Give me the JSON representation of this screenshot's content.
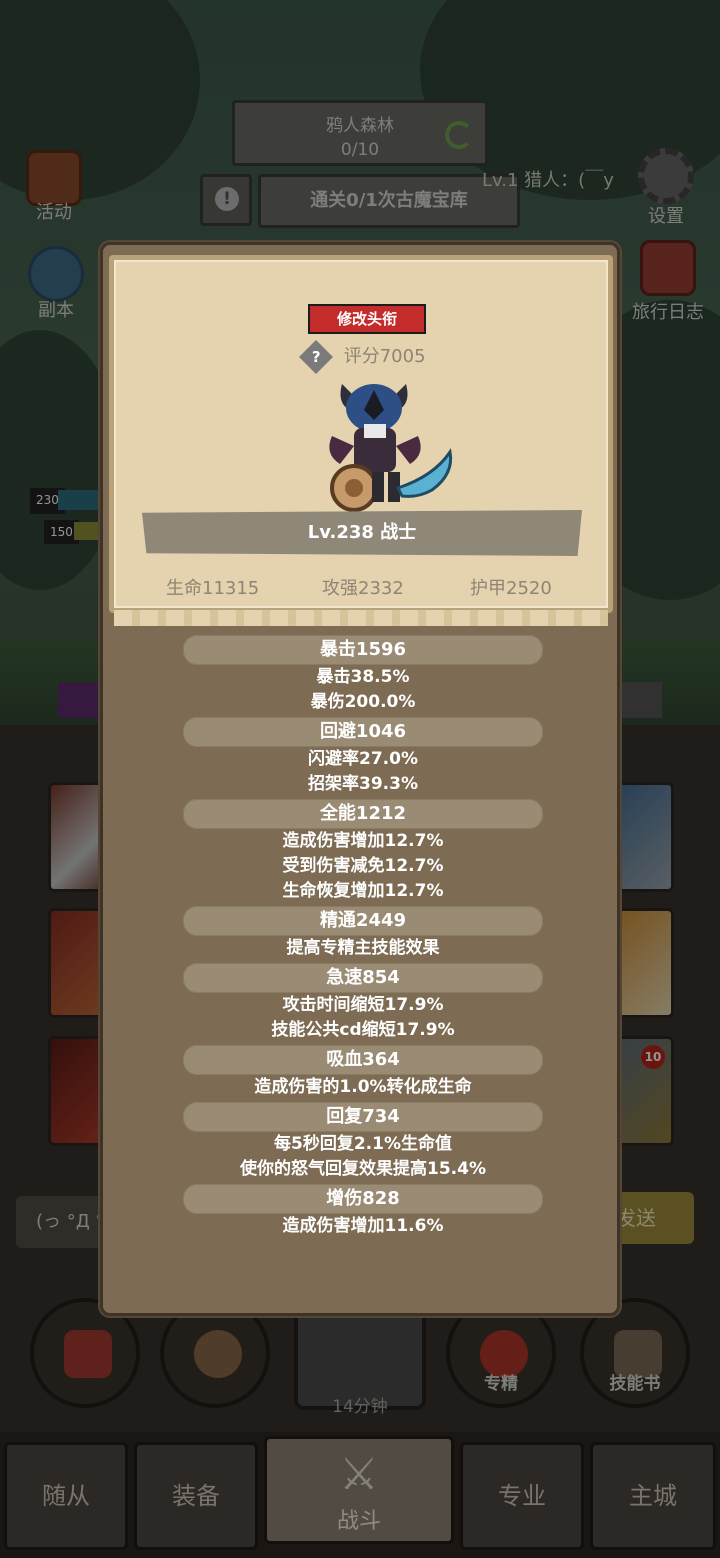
{
  "area": {
    "name": "鸦人森林",
    "progress": "0/10"
  },
  "quest": {
    "text": "通关0/1次古魔宝库",
    "icon": "!"
  },
  "hunter_label": "Lv.1 猎人：(￣y",
  "side_menu": {
    "activity": "活动",
    "dungeon": "副本",
    "settings": "设置",
    "journal": "旅行日志"
  },
  "hp_tags": {
    "a": "230",
    "b": "150"
  },
  "card_badge": "10",
  "chat": {
    "input_text": "(っ °Д °",
    "send_label": "发送"
  },
  "bottom_buttons": {
    "timer": "14分钟",
    "specialization": "专精",
    "skillbook": "技能书"
  },
  "nav": {
    "followers": "随从",
    "equipment": "装备",
    "battle": "战斗",
    "profession": "专业",
    "main_city": "主城"
  },
  "profile": {
    "edit_title_label": "修改头衔",
    "score": "评分7005",
    "score_help": "?",
    "level_class": "Lv.238 战士",
    "hp": "生命11315",
    "attack": "攻强2332",
    "armor": "护甲2520"
  },
  "attributes": [
    {
      "head": "暴击1596",
      "lines": [
        "暴击38.5%",
        "暴伤200.0%"
      ]
    },
    {
      "head": "回避1046",
      "lines": [
        "闪避率27.0%",
        "招架率39.3%"
      ]
    },
    {
      "head": "全能1212",
      "lines": [
        "造成伤害增加12.7%",
        "受到伤害减免12.7%",
        "生命恢复增加12.7%"
      ]
    },
    {
      "head": "精通2449",
      "lines": [
        "提高专精主技能效果"
      ]
    },
    {
      "head": "急速854",
      "lines": [
        "攻击时间缩短17.9%",
        "技能公共cd缩短17.9%"
      ]
    },
    {
      "head": "吸血364",
      "lines": [
        "造成伤害的1.0%转化成生命"
      ]
    },
    {
      "head": "回复734",
      "lines": [
        "每5秒回复2.1%生命值",
        "使你的怒气回复效果提高15.4%"
      ]
    },
    {
      "head": "增伤828",
      "lines": [
        "造成伤害增加11.6%"
      ]
    }
  ]
}
